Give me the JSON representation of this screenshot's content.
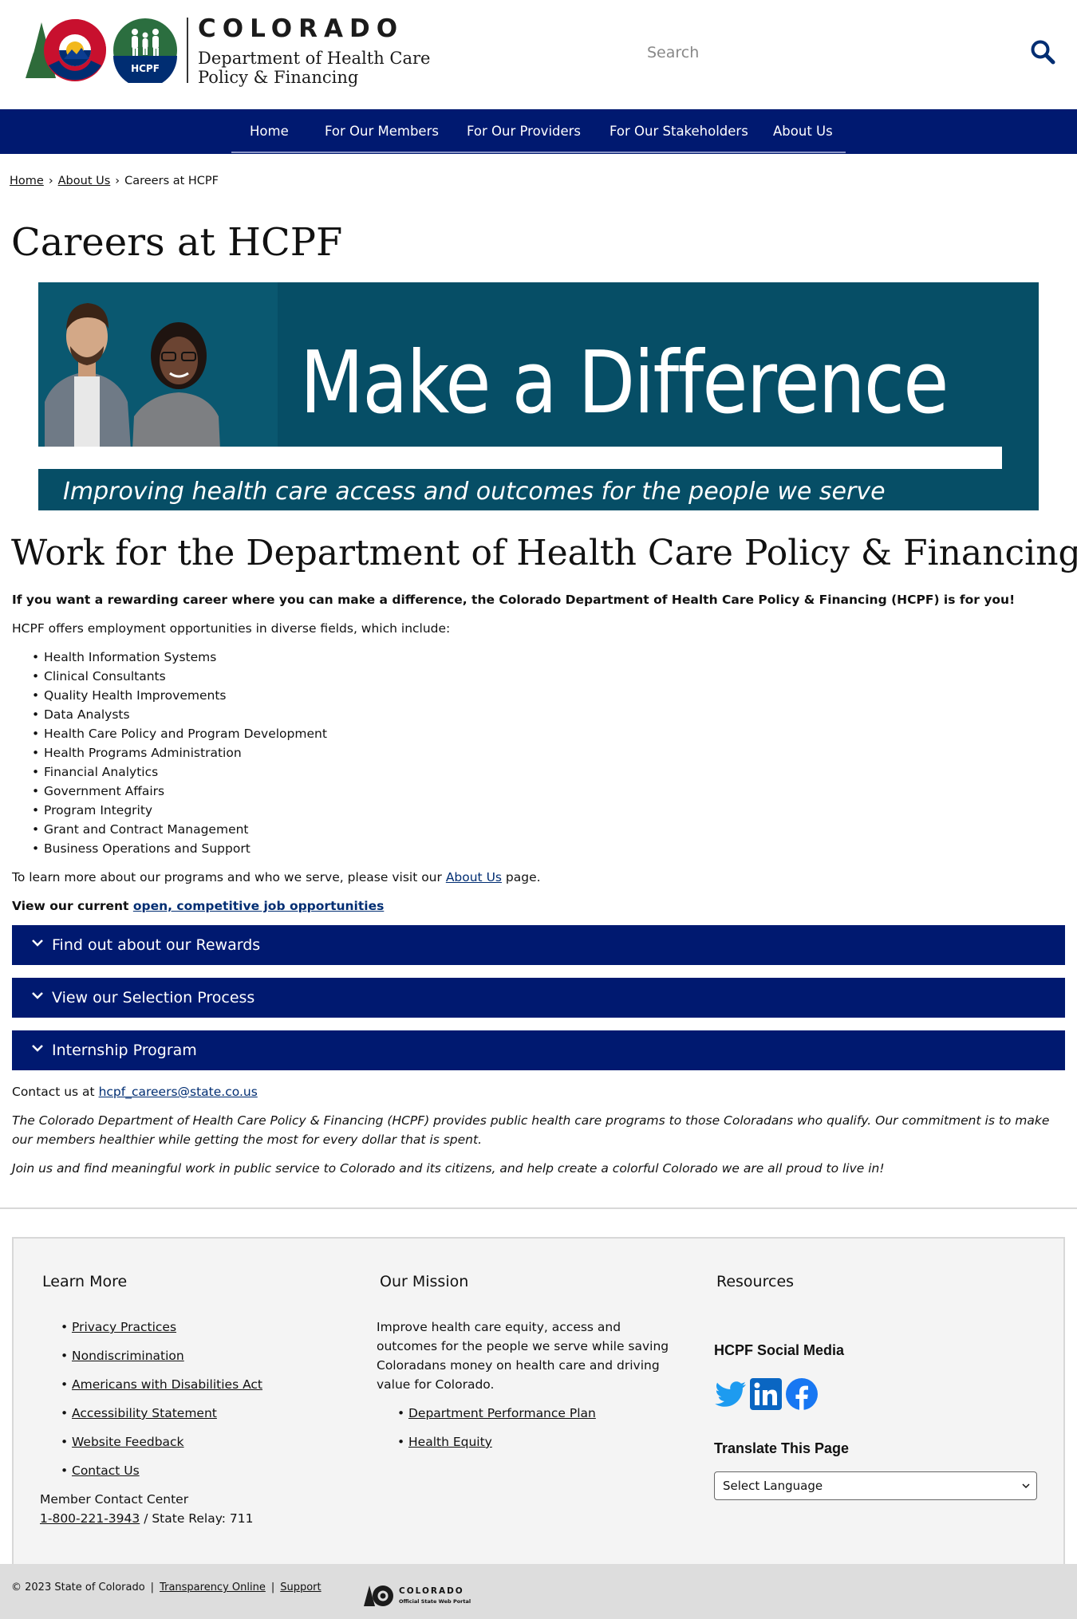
{
  "header": {
    "state_name": "COLORADO",
    "dept_line1": "Department of Health Care",
    "dept_line2": "Policy & Financing",
    "hcpf_badge": "HCPF",
    "search_placeholder": "Search"
  },
  "nav": {
    "items": [
      {
        "label": "Home"
      },
      {
        "label": "For Our Members"
      },
      {
        "label": "For Our Providers"
      },
      {
        "label": "For Our Stakeholders"
      },
      {
        "label": "About Us"
      }
    ]
  },
  "breadcrumb": {
    "home": "Home",
    "about": "About Us",
    "current": "Careers at HCPF",
    "separator": "›"
  },
  "page": {
    "title": "Careers at HCPF"
  },
  "banner": {
    "headline": "Make a Difference",
    "subline": "Improving health care access and outcomes for the people we serve"
  },
  "content": {
    "section_title": "Work for the Department of Health Care Policy & Financing",
    "intro_bold": "If you want a rewarding career where you can make a difference, the Colorado Department of Health Care Policy & Financing (HCPF) is for you!",
    "intro_2": "HCPF offers employment opportunities in diverse fields, which include:",
    "fields": [
      "Health Information Systems",
      "Clinical Consultants",
      "Quality Health Improvements",
      "Data Analysts",
      "Health Care Policy and Program Development",
      "Health Programs Administration",
      "Financial Analytics",
      "Government Affairs",
      "Program Integrity",
      "Grant and Contract Management",
      "Business Operations and Support"
    ],
    "learn_more_prefix": "To learn more about our programs and who we serve, please visit our ",
    "learn_more_link": "About Us",
    "learn_more_suffix": " page.",
    "view_jobs_prefix": "View our current ",
    "view_jobs_link": "open, competitive job opportunities",
    "accordions": [
      {
        "label": "Find out about our Rewards"
      },
      {
        "label": "View our Selection Process"
      },
      {
        "label": "Internship Program"
      }
    ],
    "contact_prefix": "Contact us at ",
    "contact_email": "hcpf_careers@state.co.us",
    "italic_1": "The Colorado Department of Health Care Policy & Financing (HCPF) provides public health care programs to those Coloradans who qualify. Our commitment is to make our members healthier while getting the most for every dollar that is spent.",
    "italic_2": "Join us and find meaningful work in public service to Colorado and its citizens, and help create a colorful Colorado we are all proud to live in!"
  },
  "footer": {
    "learn_more_heading": "Learn More",
    "learn_more_links": [
      "Privacy Practices",
      "Nondiscrimination",
      "Americans with Disabilities Act",
      "Accessibility Statement",
      "Website Feedback",
      "Contact Us"
    ],
    "contact_center_label": "Member Contact Center",
    "contact_phone": "1-800-221-3943",
    "contact_relay": " / State Relay: 711",
    "mission_heading": "Our Mission",
    "mission_text": "Improve health care equity, access and outcomes for the people we serve while saving Coloradans money on health care and driving value for Colorado.",
    "mission_links": [
      "Department Performance Plan",
      "Health Equity"
    ],
    "resources_heading": "Resources",
    "social_heading": "HCPF Social Media",
    "social_icons": [
      "twitter-icon",
      "linkedin-icon",
      "facebook-icon"
    ],
    "translate_heading": "Translate This Page",
    "language_select": "Select Language"
  },
  "bottom": {
    "copyright": "© 2023 State of Colorado",
    "transparency": "Transparency Online",
    "support": "Support",
    "pipe": "|",
    "portal_state": "COLORADO",
    "portal_sub": "Official State Web Portal"
  },
  "colors": {
    "nav_bg": "#001970",
    "accordion_bg": "#001970",
    "banner_bg": "#064e66",
    "link": "#002d72",
    "footer_bg": "#f4f4f4",
    "bottom_bar": "#dddddd"
  }
}
